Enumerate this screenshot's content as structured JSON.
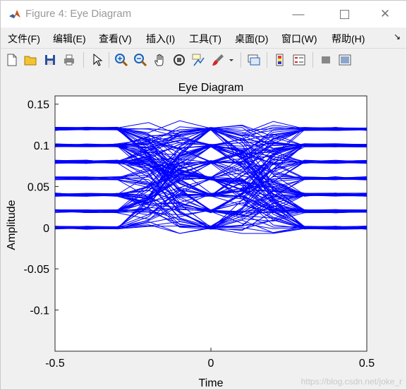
{
  "window": {
    "title": "Figure 4: Eye Diagram",
    "controls": [
      "minimize",
      "maximize",
      "close"
    ]
  },
  "menu": {
    "items": [
      "文件(F)",
      "编辑(E)",
      "查看(V)",
      "插入(I)",
      "工具(T)",
      "桌面(D)",
      "窗口(W)",
      "帮助(H)"
    ],
    "overflow_icon": "dock-arrow-icon"
  },
  "toolbar": {
    "icons": [
      "new-figure-icon",
      "open-file-icon",
      "save-icon",
      "print-icon",
      "select-pointer-icon",
      "zoom-in-icon",
      "zoom-out-icon",
      "pan-hand-icon",
      "rotate-3d-icon",
      "data-cursor-icon",
      "brush-icon",
      "dropdown-arrow-icon",
      "link-plot-icon",
      "colorbar-icon",
      "legend-icon",
      "hide-plot-tools-icon",
      "show-plot-tools-icon"
    ]
  },
  "chart_data": {
    "type": "line",
    "title": "Eye Diagram",
    "xlabel": "Time",
    "ylabel": "Amplitude",
    "xlim": [
      -0.5,
      0.5
    ],
    "ylim": [
      -0.15,
      0.16
    ],
    "xticks": [
      -0.5,
      0,
      0.5
    ],
    "xtick_labels": [
      "-0.5",
      "0",
      "0.5"
    ],
    "yticks": [
      0.15,
      0.1,
      0.05,
      0,
      -0.05,
      -0.1
    ],
    "ytick_labels": [
      "0.15",
      "0.1",
      "0.05",
      "0",
      "-0.05",
      "-0.1"
    ],
    "grid": false,
    "series_color": "#0000ff",
    "eye_x": [
      -0.5,
      -0.4,
      -0.3,
      -0.2,
      -0.1,
      0,
      0.1,
      0.2,
      0.3,
      0.4,
      0.5
    ],
    "sample_levels": [
      0,
      0.02,
      0.04,
      0.06,
      0.08,
      0.1,
      0.12
    ],
    "overshoot_max": 0.142,
    "undershoot_min": -0.007
  },
  "watermark": "https://blog.csdn.net/joke_r"
}
